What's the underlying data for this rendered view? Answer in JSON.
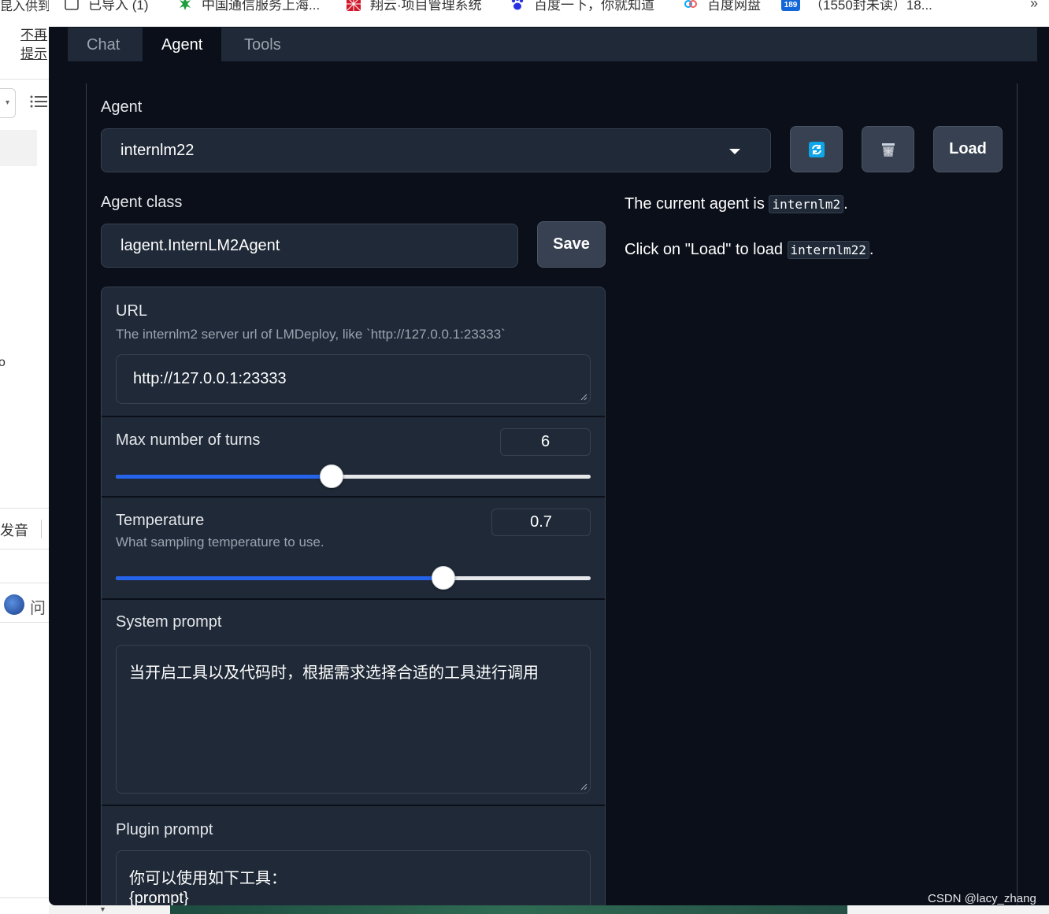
{
  "background_app": {
    "text_top": "昆入供到",
    "link_1": "不再",
    "link_2": "提示",
    "text_mid": "o",
    "text_pron": "发音",
    "text_ask": "问"
  },
  "bookmarks": [
    {
      "label": "已导入 (1)",
      "icon": "folder-icon"
    },
    {
      "label": "中国通信服务上海...",
      "icon": "green-logo-icon"
    },
    {
      "label": "翔云·项目管理系统",
      "icon": "red-grid-icon"
    },
    {
      "label": "百度一下，你就知道",
      "icon": "baidu-paw-icon"
    },
    {
      "label": "百度网盘",
      "icon": "baidu-netdisk-icon"
    },
    {
      "label": "（1550封未读）18...",
      "icon": "mail-189-icon"
    }
  ],
  "tabs": [
    {
      "label": "Chat"
    },
    {
      "label": "Agent"
    },
    {
      "label": "Tools"
    }
  ],
  "active_tab": "Agent",
  "agent": {
    "label": "Agent",
    "selected": "internlm22",
    "load_label": "Load"
  },
  "agent_class": {
    "label": "Agent class",
    "value": "lagent.InternLM2Agent",
    "save_label": "Save"
  },
  "status": {
    "current_prefix": "The current agent is ",
    "current_agent": "internlm2",
    "current_suffix": ".",
    "load_prefix": "Click on \"Load\" to load ",
    "load_agent": "internlm22",
    "load_suffix": "."
  },
  "settings": {
    "url": {
      "label": "URL",
      "info": "The internlm2 server url of LMDeploy, like `http://127.0.0.1:23333`",
      "value": "http://127.0.0.1:23333"
    },
    "max_turns": {
      "label": "Max number of turns",
      "value": "6",
      "fraction": 0.455
    },
    "temperature": {
      "label": "Temperature",
      "info": "What sampling temperature to use.",
      "value": "0.7",
      "fraction": 0.69
    },
    "system_prompt": {
      "label": "System prompt",
      "value": "当开启工具以及代码时，根据需求选择合适的工具进行调用"
    },
    "plugin_prompt": {
      "label": "Plugin prompt",
      "line_1": "你可以使用如下工具：",
      "line_2": "{prompt}"
    }
  },
  "watermark": "CSDN @lacy_zhang",
  "colors": {
    "page_bg": "#0b0f19",
    "panel_bg": "#1f2937",
    "border": "#374151",
    "button_bg": "#374151",
    "slider_fill": "#2563eb",
    "refresh_icon": "#0ea5e9",
    "text_muted": "#9ca3af"
  }
}
